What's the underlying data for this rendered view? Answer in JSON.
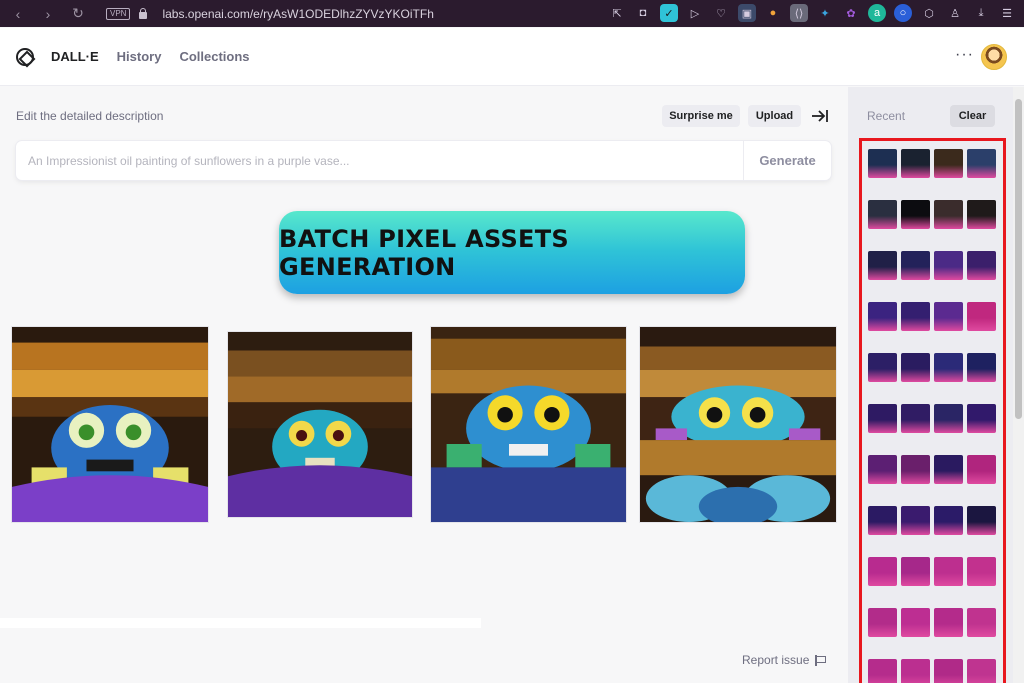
{
  "browser": {
    "vpn_label": "VPN",
    "url": "labs.openai.com/e/ryAsW1ODEDlhzZYVzYKOiTFh",
    "nav_icons": [
      "back-icon",
      "forward-icon",
      "reload-icon"
    ],
    "extension_icons": [
      "share-icon",
      "camera-icon",
      "shield-icon",
      "send-icon",
      "heart-icon",
      "translate-icon",
      "medal-icon",
      "code-icon",
      "puzzle-icon",
      "paw-icon",
      "a-icon",
      "circle-icon",
      "cube-icon",
      "profile-icon",
      "download-icon",
      "settings-icon"
    ]
  },
  "header": {
    "brand": "DALL·E",
    "nav": [
      "History",
      "Collections"
    ],
    "more_label": "···"
  },
  "prompt": {
    "label": "Edit the detailed description",
    "surprise_label": "Surprise me",
    "upload_label": "Upload",
    "placeholder": "An Impressionist oil painting of sunflowers in a purple vase...",
    "generate_label": "Generate"
  },
  "banner": {
    "text": "BATCH PIXEL ASSETS GENERATION"
  },
  "results": [
    {
      "name": "monster-under-bed-1",
      "palette": {
        "bg": "#c2811e",
        "creature": "#2b71c4",
        "blanket": "#7b3fc8"
      }
    },
    {
      "name": "monster-under-bed-2",
      "palette": {
        "bg": "#6a4517",
        "creature": "#23a8c2",
        "blanket": "#5e2fa2"
      }
    },
    {
      "name": "monster-under-bed-3",
      "palette": {
        "bg": "#8a5a1c",
        "creature": "#2e8fd0",
        "blanket": "#2f3f8f"
      }
    },
    {
      "name": "monster-under-bed-4",
      "palette": {
        "bg": "#b67a2a",
        "creature": "#3ab3cf",
        "blanket": "#2c6fae"
      }
    }
  ],
  "footer": {
    "report_label": "Report issue"
  },
  "sidebar": {
    "title": "Recent",
    "clear_label": "Clear",
    "thumb_rows": [
      [
        "#1d2f52",
        "#1a2230",
        "#3b2a1c",
        "#2b3f6a"
      ],
      [
        "#2a2f40",
        "#0c0c10",
        "#3a2c2c",
        "#1f1a1a"
      ],
      [
        "#202047",
        "#23225a",
        "#4b2a86",
        "#3b1f6b"
      ],
      [
        "#3b2380",
        "#341f70",
        "#5b2a90",
        "#c0287f"
      ],
      [
        "#2c1f66",
        "#2a1c60",
        "#2b2a78",
        "#1e2160"
      ],
      [
        "#2e1a63",
        "#301c64",
        "#2a2565",
        "#31196b"
      ],
      [
        "#5c1f73",
        "#6a1f6b",
        "#2a1a60",
        "#b0257e"
      ],
      [
        "#2b1a63",
        "#3a1b6e",
        "#2b1b68",
        "#1b1640"
      ],
      [
        "#b82b8f",
        "#a6288a",
        "#bd2f8f",
        "#c2318e"
      ],
      [
        "#b22c8a",
        "#bd2e92",
        "#b42b8b",
        "#c0338f"
      ],
      [
        "#b52c8c",
        "#bb2f90",
        "#b02a88",
        "#bf3490"
      ]
    ]
  }
}
